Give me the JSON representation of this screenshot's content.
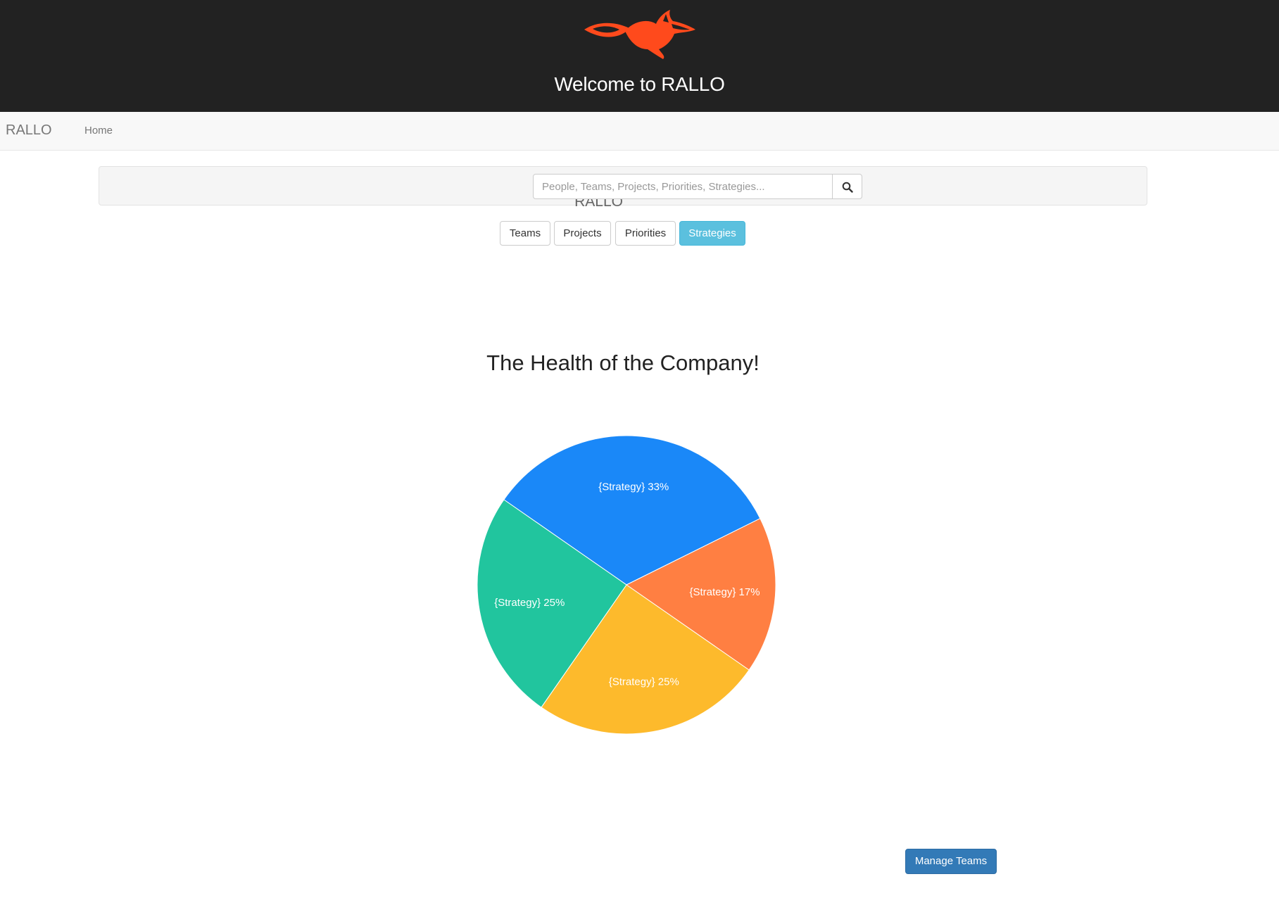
{
  "header": {
    "title": "Welcome to RALLO",
    "logo": "fox-logo",
    "background": "#222222",
    "logo_color": "#ff4a1c"
  },
  "navbar": {
    "brand": "RALLO",
    "links": [
      "Home"
    ]
  },
  "search": {
    "label": "Search RALLO",
    "placeholder": "People, Teams, Projects, Priorities, Strategies...",
    "value": "",
    "button_icon": "search-icon"
  },
  "tabs": [
    {
      "label": "Teams",
      "active": false
    },
    {
      "label": "Projects",
      "active": false
    },
    {
      "label": "Priorities",
      "active": false
    },
    {
      "label": "Strategies",
      "active": true
    }
  ],
  "chart_data": {
    "type": "pie",
    "title": "The Health of the Company!",
    "slices": [
      {
        "label": "{Strategy} 33%",
        "value": 33,
        "color": "#1a88f8"
      },
      {
        "label": "{Strategy} 17%",
        "value": 17,
        "color": "#ff7f42"
      },
      {
        "label": "{Strategy} 25%",
        "value": 25,
        "color": "#fdba2c"
      },
      {
        "label": "{Strategy} 25%",
        "value": 25,
        "color": "#21c59e"
      }
    ],
    "start": "top, clockwise",
    "legend": "none"
  },
  "actions": {
    "manage_teams": "Manage Teams"
  }
}
